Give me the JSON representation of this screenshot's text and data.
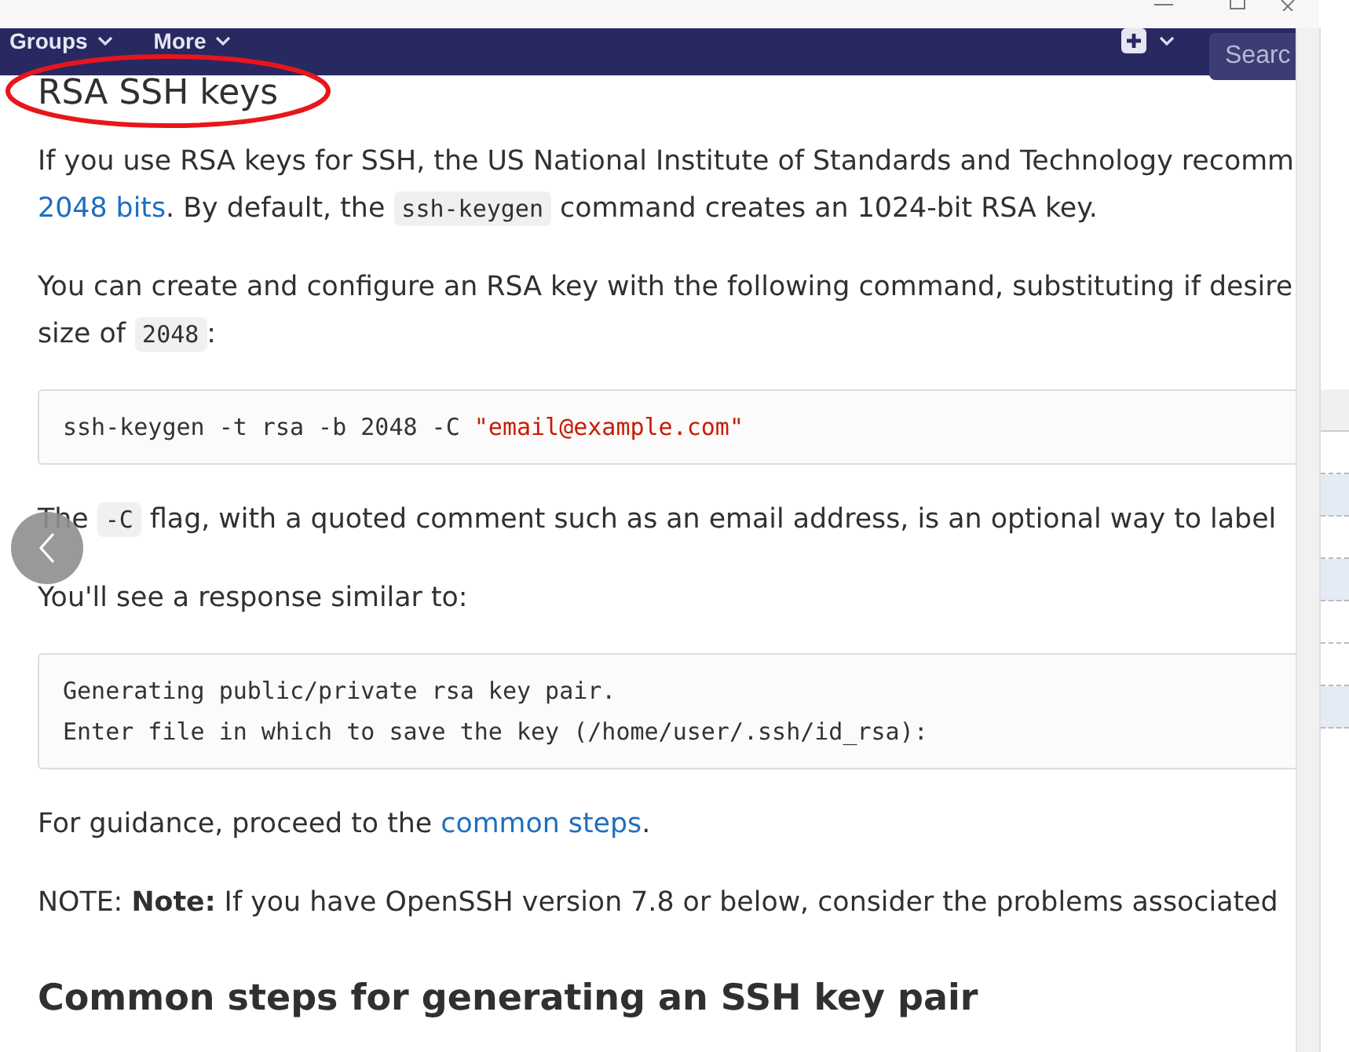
{
  "nav": {
    "items": [
      {
        "label": "Groups"
      },
      {
        "label": "More"
      }
    ],
    "search": {
      "placeholder": "Searc"
    }
  },
  "heading": "RSA SSH keys",
  "content": [
    {
      "kind": "paragraph",
      "lines": [
        [
          {
            "kind": "text",
            "text": "If you use RSA keys for SSH, the US National Institute of Standards and Technology recomm"
          }
        ],
        [
          {
            "kind": "link",
            "text": "2048 bits"
          },
          {
            "kind": "text",
            "text": ". By default, the "
          },
          {
            "kind": "code",
            "text": "ssh-keygen"
          },
          {
            "kind": "text",
            "text": " command creates an 1024-bit RSA key."
          }
        ]
      ]
    },
    {
      "kind": "paragraph",
      "lines": [
        [
          {
            "kind": "text",
            "text": "You can create and configure an RSA key with the following command, substituting if desire"
          }
        ],
        [
          {
            "kind": "text",
            "text": "size of "
          },
          {
            "kind": "code",
            "text": "2048"
          },
          {
            "kind": "text",
            "text": ":"
          }
        ]
      ]
    },
    {
      "kind": "codeblock",
      "lines": [
        [
          {
            "kind": "plain",
            "text": "ssh-keygen -t rsa -b 2048 -C "
          },
          {
            "kind": "string",
            "text": "\"email@example.com\""
          }
        ]
      ]
    },
    {
      "kind": "paragraph",
      "lines": [
        [
          {
            "kind": "text",
            "text": "The "
          },
          {
            "kind": "code",
            "text": "-C"
          },
          {
            "kind": "text",
            "text": " flag, with a quoted comment such as an email address, is an optional way to label"
          }
        ]
      ]
    },
    {
      "kind": "paragraph",
      "lines": [
        [
          {
            "kind": "text",
            "text": "You'll see a response similar to:"
          }
        ]
      ]
    },
    {
      "kind": "codeblock",
      "lines": [
        [
          {
            "kind": "plain",
            "text": "Generating public/private rsa key pair."
          }
        ],
        [
          {
            "kind": "plain",
            "text": "Enter file in which to save the key (/home/user/.ssh/id_rsa):"
          }
        ]
      ]
    },
    {
      "kind": "paragraph",
      "lines": [
        [
          {
            "kind": "text",
            "text": "For guidance, proceed to the "
          },
          {
            "kind": "link",
            "text": "common steps"
          },
          {
            "kind": "text",
            "text": "."
          }
        ]
      ]
    },
    {
      "kind": "paragraph",
      "lines": [
        [
          {
            "kind": "text",
            "text": "NOTE: **Note:** If you have OpenSSH version 7.8 or below, consider the problems associated"
          }
        ]
      ]
    },
    {
      "kind": "subheading",
      "text": "Common steps for generating an SSH key pair"
    }
  ]
}
